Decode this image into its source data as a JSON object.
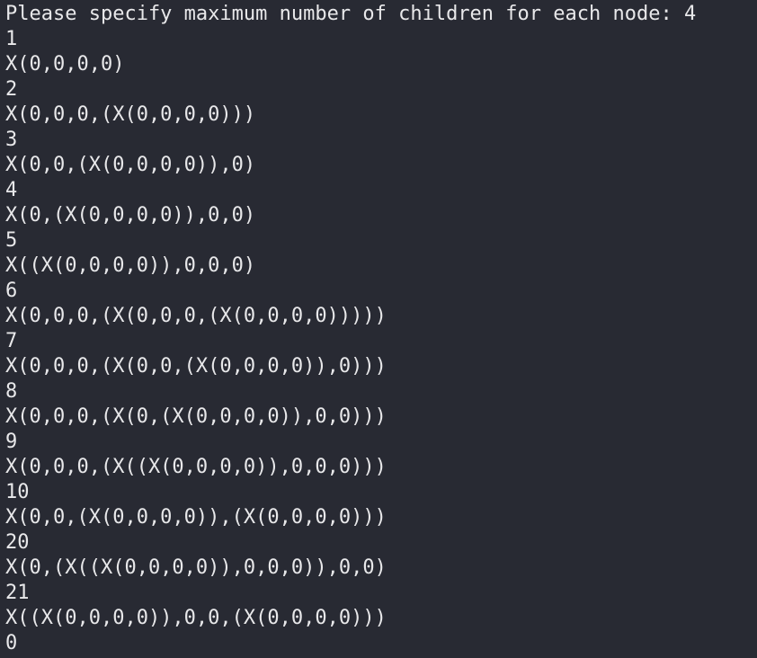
{
  "terminal": {
    "prompt_line": "Please specify maximum number of children for each node: 4",
    "output": [
      "1",
      "X(0,0,0,0)",
      "2",
      "X(0,0,0,(X(0,0,0,0)))",
      "3",
      "X(0,0,(X(0,0,0,0)),0)",
      "4",
      "X(0,(X(0,0,0,0)),0,0)",
      "5",
      "X((X(0,0,0,0)),0,0,0)",
      "6",
      "X(0,0,0,(X(0,0,0,(X(0,0,0,0)))))",
      "7",
      "X(0,0,0,(X(0,0,(X(0,0,0,0)),0)))",
      "8",
      "X(0,0,0,(X(0,(X(0,0,0,0)),0,0)))",
      "9",
      "X(0,0,0,(X((X(0,0,0,0)),0,0,0)))",
      "10",
      "X(0,0,(X(0,0,0,0)),(X(0,0,0,0)))",
      "20",
      "X(0,(X((X(0,0,0,0)),0,0,0)),0,0)",
      "21",
      "X((X(0,0,0,0)),0,0,(X(0,0,0,0)))"
    ],
    "input_line": "0"
  }
}
